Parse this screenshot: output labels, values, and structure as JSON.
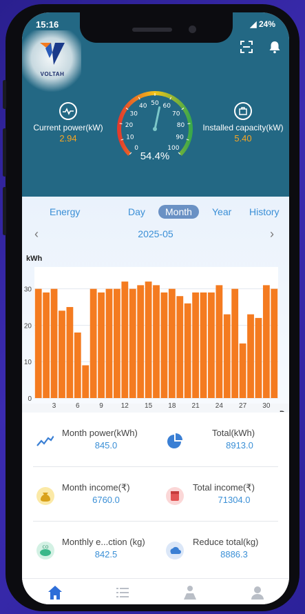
{
  "status": {
    "time": "15:16",
    "battery": "24%"
  },
  "header": {
    "logo_text": "VOLTAH",
    "current_power_label": "Current power(kW)",
    "current_power_value": "2.94",
    "installed_capacity_label": "Installed capacity(kW)",
    "installed_capacity_value": "5.40",
    "gauge_percent": "54.4%",
    "gauge_value_fraction": 0.544,
    "gauge_ticks": [
      "0",
      "10",
      "20",
      "30",
      "40",
      "50",
      "60",
      "70",
      "80",
      "90",
      "100"
    ]
  },
  "tabs": {
    "energy": "Energy",
    "day": "Day",
    "month": "Month",
    "year": "Year",
    "history": "History",
    "active": "Month"
  },
  "month_nav": {
    "label": "2025-05",
    "prev": "‹",
    "next": "›"
  },
  "chart_data": {
    "type": "bar",
    "ylabel": "kWh",
    "xlabel": "D",
    "ylim": [
      0,
      36
    ],
    "y_ticks": [
      0,
      10,
      20,
      30
    ],
    "x_ticks": [
      3,
      6,
      9,
      12,
      15,
      18,
      21,
      24,
      27,
      30
    ],
    "categories": [
      1,
      2,
      3,
      4,
      5,
      6,
      7,
      8,
      9,
      10,
      11,
      12,
      13,
      14,
      15,
      16,
      17,
      18,
      19,
      20,
      21,
      22,
      23,
      24,
      25,
      26,
      27,
      28,
      29,
      30,
      31
    ],
    "values": [
      30,
      29,
      30,
      24,
      25,
      18,
      9,
      30,
      29,
      30,
      30,
      32,
      30,
      31,
      32,
      31,
      29,
      30,
      28,
      26,
      29,
      29,
      29,
      31,
      23,
      30,
      15,
      23,
      22,
      31,
      30
    ],
    "bar_color": "#f47b20"
  },
  "stats": {
    "month_power_label": "Month power(kWh)",
    "month_power_value": "845.0",
    "total_label": "Total(kWh)",
    "total_value": "8913.0",
    "month_income_label": "Month income(₹)",
    "month_income_value": "6760.0",
    "total_income_label": "Total income(₹)",
    "total_income_value": "71304.0",
    "monthly_reduction_label": "Monthly e...ction (kg)",
    "monthly_reduction_value": "842.5",
    "reduce_total_label": "Reduce total(kg)",
    "reduce_total_value": "8886.3"
  },
  "colors": {
    "header_bg": "#236884",
    "accent_blue": "#3a8fd6",
    "bar_orange": "#f47b20",
    "value_orange": "#f6a623"
  },
  "icons": {
    "nav": [
      "home-icon",
      "list-icon",
      "map-person-icon",
      "user-icon"
    ],
    "top": [
      "scan-icon",
      "bell-icon"
    ]
  }
}
